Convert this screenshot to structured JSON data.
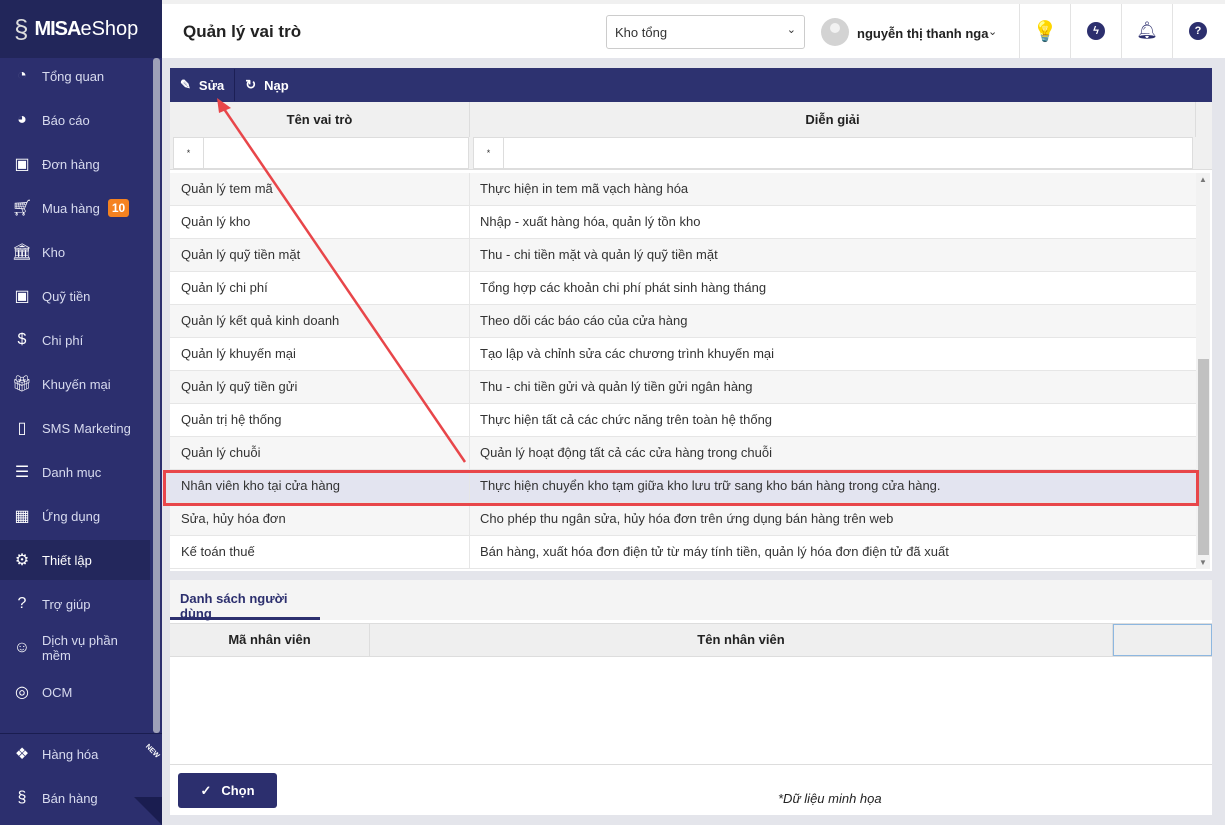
{
  "app": {
    "logo_text_bold": "MISA",
    "logo_text": "eShop"
  },
  "sidebar": {
    "items": [
      {
        "label": "Tổng quan",
        "icon": "dashboard-icon"
      },
      {
        "label": "Báo cáo",
        "icon": "pie-chart-icon"
      },
      {
        "label": "Đơn hàng",
        "icon": "order-icon"
      },
      {
        "label": "Mua hàng",
        "icon": "cart-icon",
        "badge": "10"
      },
      {
        "label": "Kho",
        "icon": "warehouse-icon"
      },
      {
        "label": "Quỹ tiền",
        "icon": "safe-icon"
      },
      {
        "label": "Chi phí",
        "icon": "expense-icon"
      },
      {
        "label": "Khuyến mại",
        "icon": "gift-icon"
      },
      {
        "label": "SMS Marketing",
        "icon": "phone-icon"
      },
      {
        "label": "Danh mục",
        "icon": "list-icon"
      },
      {
        "label": "Ứng dụng",
        "icon": "apps-icon"
      },
      {
        "label": "Thiết lập",
        "icon": "gear-icon"
      },
      {
        "label": "Trợ giúp",
        "icon": "help-icon"
      },
      {
        "label": "Dịch vụ phần mềm",
        "icon": "user-icon"
      },
      {
        "label": "OCM",
        "icon": "ocm-icon"
      }
    ],
    "bottom": [
      {
        "label": "Hàng hóa",
        "icon": "boxes-icon"
      },
      {
        "label": "Bán hàng",
        "icon": "sales-icon",
        "tag": "NEW"
      }
    ]
  },
  "header": {
    "title": "Quản lý vai trò",
    "store": "Kho tổng",
    "user": "nguyễn thị thanh nga"
  },
  "toolbar": {
    "edit": "Sửa",
    "reload": "Nạp"
  },
  "roles_table": {
    "columns": [
      "Tên vai trò",
      "Diễn giải"
    ],
    "filter_op": "*",
    "rows": [
      [
        "Quản lý tem mã",
        "Thực hiện in tem mã vạch hàng hóa"
      ],
      [
        "Quản lý kho",
        "Nhập - xuất hàng hóa, quản lý tồn kho"
      ],
      [
        "Quản lý quỹ tiền mặt",
        "Thu - chi tiền mặt và quản lý quỹ tiền mặt"
      ],
      [
        "Quản lý chi phí",
        "Tổng hợp các khoản chi phí phát sinh hàng tháng"
      ],
      [
        "Quản lý kết quả kinh doanh",
        "Theo dõi các báo cáo của cửa hàng"
      ],
      [
        "Quản lý khuyến mại",
        "Tạo lập và chỉnh sửa các chương trình khuyến mại"
      ],
      [
        "Quản lý quỹ tiền gửi",
        "Thu - chi tiền gửi và quản lý tiền gửi ngân hàng"
      ],
      [
        "Quản trị hệ thống",
        "Thực hiện tất cả các chức năng trên toàn hệ thống"
      ],
      [
        "Quản lý chuỗi",
        "Quản lý hoạt động tất cả các cửa hàng trong chuỗi"
      ],
      [
        "Nhân viên kho tại cửa hàng",
        "Thực hiện chuyển kho tạm giữa kho lưu trữ sang kho bán hàng trong cửa hàng."
      ],
      [
        "Sửa, hủy hóa đơn",
        "Cho phép thu ngân sửa, hủy hóa đơn trên ứng dụng bán hàng trên web"
      ],
      [
        "Kế toán thuế",
        "Bán hàng, xuất hóa đơn điện tử từ máy tính tiền, quản lý hóa đơn điện tử đã xuất"
      ]
    ],
    "selected_index": 9
  },
  "users": {
    "tab": "Danh sách người dùng",
    "columns": [
      "Mã nhân viên",
      "Tên nhân viên"
    ]
  },
  "footer": {
    "choose": "Chọn",
    "note": "*Dữ liệu minh họa"
  },
  "colors": {
    "navy": "#2c2f6e",
    "accent": "#f58220",
    "highlight": "#e8464a"
  }
}
